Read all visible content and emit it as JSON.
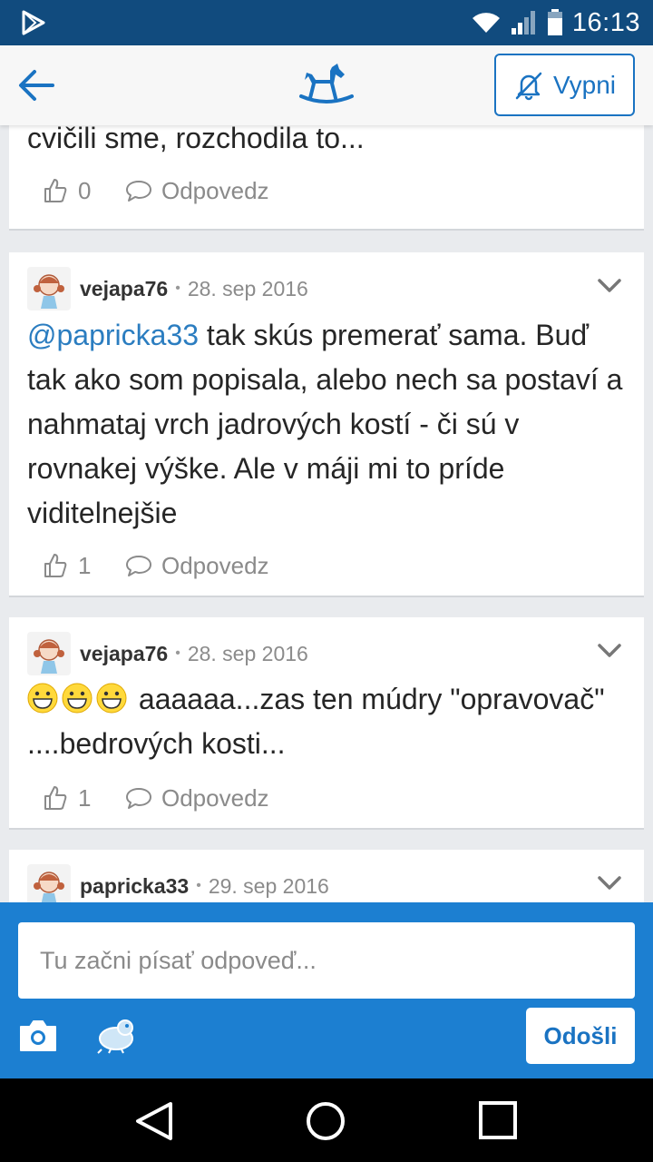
{
  "status_bar": {
    "time": "16:13"
  },
  "app_bar": {
    "mute_label": "Vypni",
    "accent": "#1a73c2"
  },
  "comments": [
    {
      "body_tail": "cvičili sme, rozchodila to...",
      "likes": "0",
      "reply_label": "Odpovedz"
    },
    {
      "username": "vejapa76",
      "date": "28. sep 2016",
      "mention": "@papricka33",
      "body": " tak skús premerať sama. Buď tak ako som popisala, alebo nech sa postaví a nahmataj vrch jadrových kostí - či sú v rovnakej výške. Ale v máji mi to príde viditelnejšie",
      "likes": "1",
      "reply_label": "Odpovedz"
    },
    {
      "username": "vejapa76",
      "date": "28. sep 2016",
      "body": "aaaaaa...zas ten múdry \"opravovač\" ....bedrových kosti...",
      "likes": "1",
      "reply_label": "Odpovedz"
    },
    {
      "username": "papricka33",
      "date": "29. sep 2016"
    }
  ],
  "compose": {
    "placeholder": "Tu začni písať odpoveď...",
    "send_label": "Odošli"
  }
}
